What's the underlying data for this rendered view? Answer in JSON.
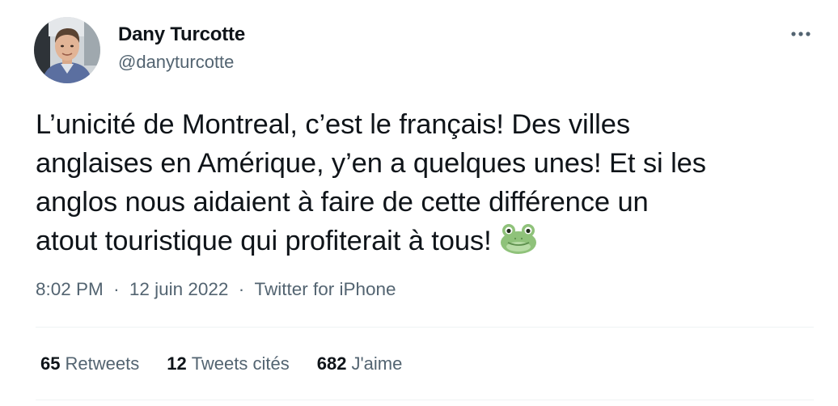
{
  "author": {
    "name": "Dany Turcotte",
    "handle": "@danyturcotte"
  },
  "tweet": {
    "lines": [
      "L’unicité de Montreal, c’est le français! Des villes",
      "anglaises en Amérique, y’en a quelques unes! Et si les",
      "anglos nous aidaient à faire de cette différence un",
      "atout touristique qui profiterait à tous!"
    ],
    "emoji": "frog-face-emoji"
  },
  "meta": {
    "time": "8:02 PM",
    "separator": "·",
    "date": "12 juin 2022",
    "source": "Twitter for iPhone"
  },
  "stats": [
    {
      "count": "65",
      "label": "Retweets"
    },
    {
      "count": "12",
      "label": "Tweets cités"
    },
    {
      "count": "682",
      "label": "J'aime"
    }
  ],
  "icons": {
    "more": "more-horizontal-icon"
  },
  "colors": {
    "text_primary": "#0f1419",
    "text_secondary": "#536471",
    "divider": "#eff3f4"
  }
}
